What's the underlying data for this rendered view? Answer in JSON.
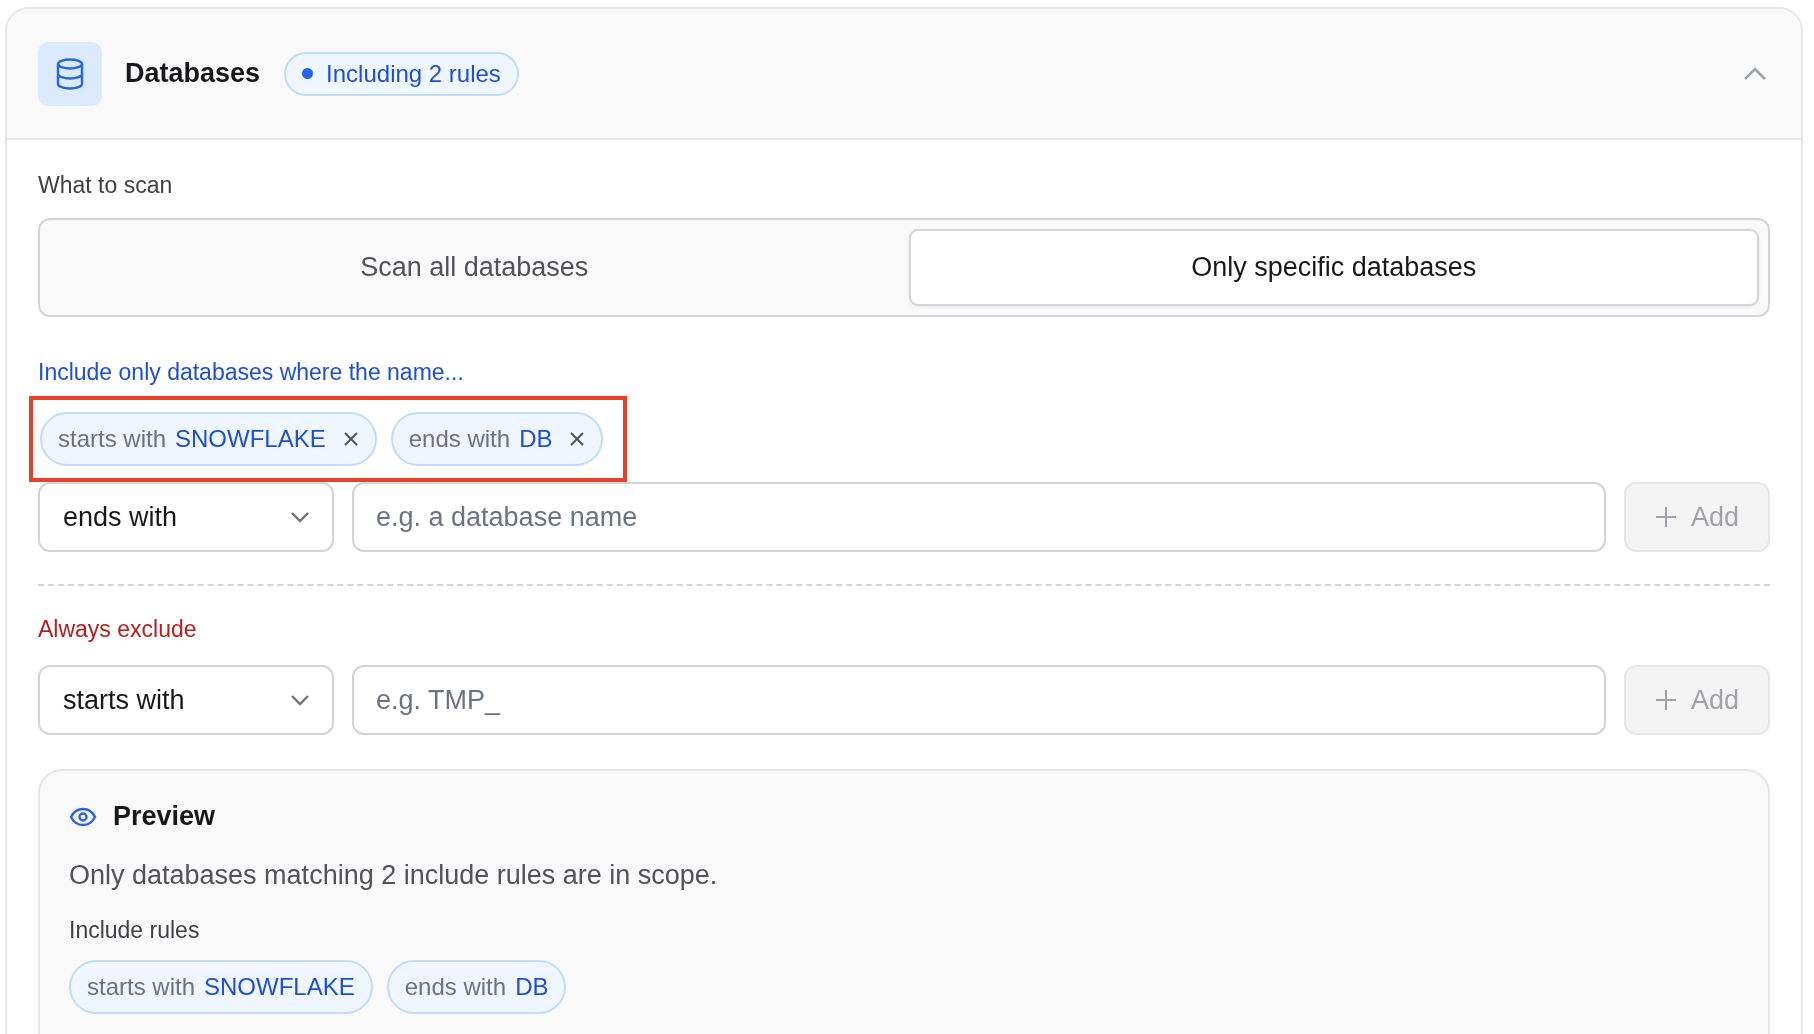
{
  "section": {
    "title": "Databases",
    "badge": "Including 2 rules",
    "expanded": true
  },
  "scan": {
    "label": "What to scan",
    "options": [
      {
        "label": "Scan all databases",
        "selected": false
      },
      {
        "label": "Only specific databases",
        "selected": true
      }
    ]
  },
  "include": {
    "label": "Include only databases where the name...",
    "highlighted": true,
    "rules": [
      {
        "operator": "starts with",
        "value": "SNOWFLAKE"
      },
      {
        "operator": "ends with",
        "value": "DB"
      }
    ],
    "select": "ends with",
    "placeholder": "e.g. a database name",
    "add": {
      "label": "Add",
      "disabled": true
    }
  },
  "exclude": {
    "label": "Always exclude",
    "select": "starts with",
    "placeholder": "e.g. TMP_",
    "add": {
      "label": "Add",
      "disabled": true
    }
  },
  "preview": {
    "title": "Preview",
    "summary": "Only databases matching 2 include rules are in scope.",
    "rules_label": "Include rules",
    "rules": [
      {
        "operator": "starts with",
        "value": "SNOWFLAKE"
      },
      {
        "operator": "ends with",
        "value": "DB"
      }
    ]
  }
}
